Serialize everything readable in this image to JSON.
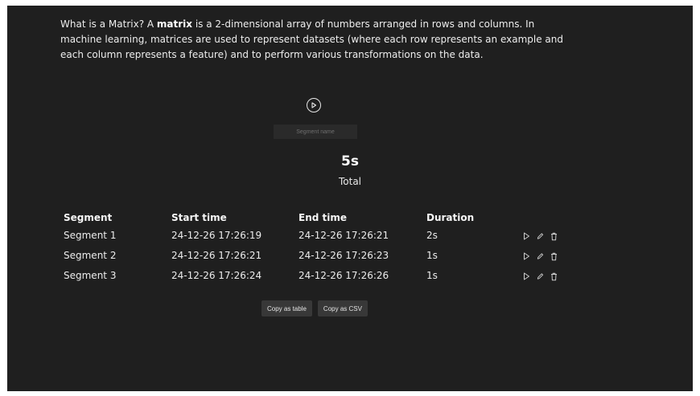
{
  "intro": {
    "part1": "What is a Matrix? A ",
    "bold": "matrix",
    "part2": " is a 2-dimensional array of numbers arranged in rows and columns. In machine learning, matrices are used to represent datasets (where each row represents an example and each column represents a feature) and to perform various transformations on the data."
  },
  "player": {
    "play_icon": "play-circle-icon"
  },
  "segment_input": {
    "placeholder": "Segment name",
    "value": ""
  },
  "total": {
    "value": "5s",
    "label": "Total"
  },
  "table": {
    "headers": [
      "Segment",
      "Start time",
      "End time",
      "Duration"
    ],
    "rows": [
      {
        "segment": "Segment 1",
        "start": "24-12-26 17:26:19",
        "end": "24-12-26 17:26:21",
        "duration": "2s"
      },
      {
        "segment": "Segment 2",
        "start": "24-12-26 17:26:21",
        "end": "24-12-26 17:26:23",
        "duration": "1s"
      },
      {
        "segment": "Segment 3",
        "start": "24-12-26 17:26:24",
        "end": "24-12-26 17:26:26",
        "duration": "1s"
      }
    ],
    "row_action_icons": [
      "play-icon",
      "pencil-icon",
      "trash-icon"
    ]
  },
  "buttons": {
    "copy_table": "Copy as table",
    "copy_csv": "Copy as CSV"
  },
  "colors": {
    "background": "#1f1f1f",
    "text": "#f2f2f2",
    "button": "#383838",
    "input": "#2a2a2a"
  }
}
